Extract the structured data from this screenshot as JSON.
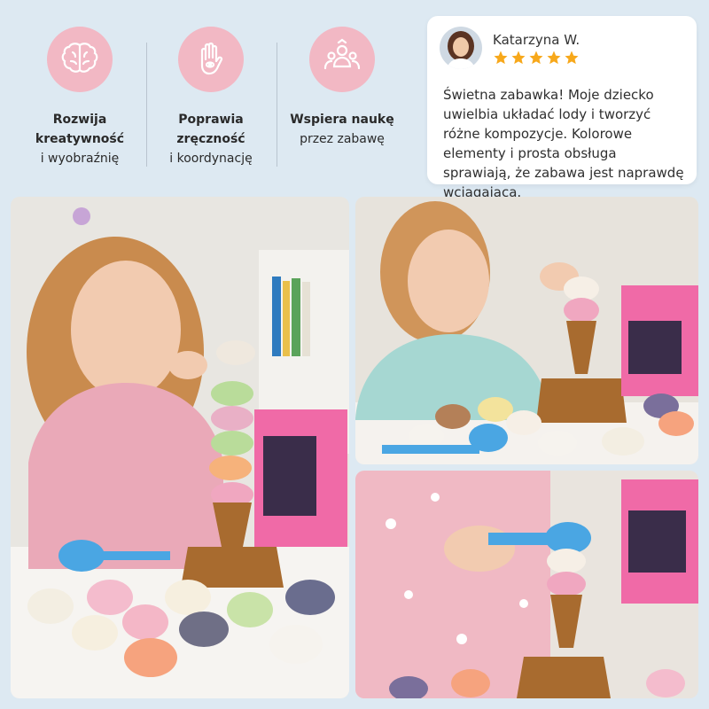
{
  "features": [
    {
      "icon": "brain-icon",
      "bold_line1": "Rozwija",
      "bold_line2": "kreatywność",
      "sub": "i wyobraźnię"
    },
    {
      "icon": "hand-icon",
      "bold_line1": "Poprawia",
      "bold_line2": "zręczność",
      "sub": "i koordynację"
    },
    {
      "icon": "people-icon",
      "bold_line1": "Wspiera naukę",
      "bold_line2": "",
      "sub": "przez zabawę"
    }
  ],
  "review": {
    "name": "Katarzyna W.",
    "rating": 5,
    "text": "Świetna zabawka! Moje dziecko uwielbia układać lody i tworzyć różne kompozycje. Kolorowe elementy i prosta obsługa sprawiają, że zabawa jest naprawdę wciągająca."
  },
  "colors": {
    "background": "#dde9f2",
    "icon_circle": "#f2b8c4",
    "star": "#f7a81b"
  }
}
